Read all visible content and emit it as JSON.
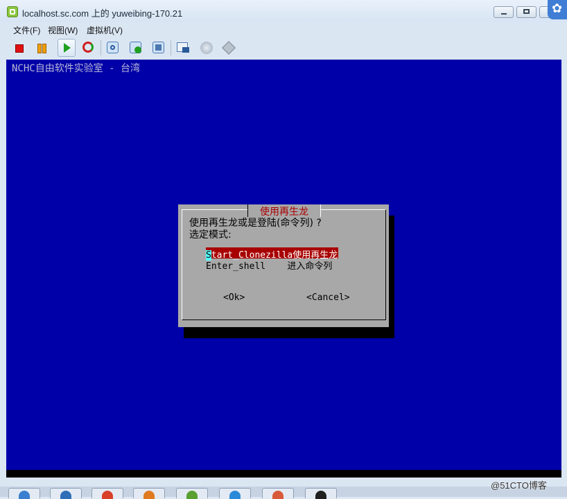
{
  "window": {
    "title": "localhost.sc.com 上的 yuweibing-170.21"
  },
  "menu": {
    "items": [
      "文件(F)",
      "视图(W)",
      "虚拟机(V)"
    ]
  },
  "toolbar": {
    "icons": [
      "stop-icon",
      "pause-icon",
      "play-icon",
      "reset-icon",
      "snapshot-icon",
      "revert-snapshot-icon",
      "manage-snapshots-icon",
      "settings-icon",
      "network-icon",
      "tools-icon"
    ]
  },
  "console": {
    "header": "NCHC自由软件实验室 - 台湾",
    "dialog": {
      "title": "使用再生龙",
      "prompt_line1": "使用再生龙或是登陆(命令列) ?",
      "prompt_line2": "选定模式:",
      "options": [
        {
          "key_first": "S",
          "key_rest": "tart_Clonezilla",
          "desc": "使用再生龙",
          "selected": true
        },
        {
          "key": "Enter_shell",
          "desc": "进入命令列",
          "selected": false
        }
      ],
      "ok_label": "<Ok>",
      "cancel_label": "<Cancel>"
    }
  },
  "watermark": "@51CTO博客",
  "colors": {
    "console_bg": "#0000a8",
    "dialog_bg": "#a8a8a8",
    "selected_bg": "#a80000",
    "hotkey_bg": "#55ffff"
  }
}
